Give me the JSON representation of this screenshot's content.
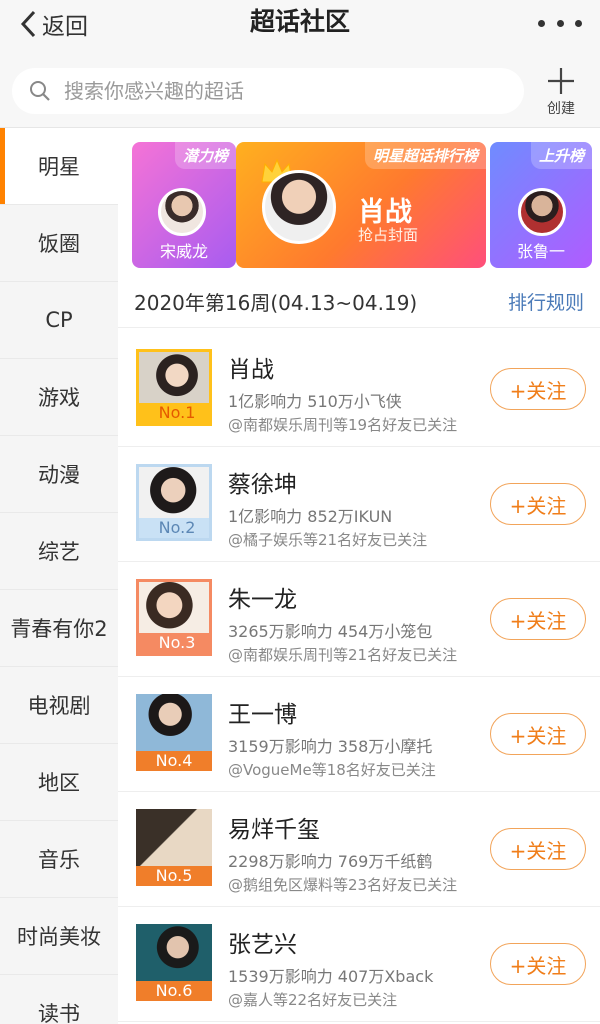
{
  "header": {
    "back_label": "返回",
    "title": "超话社区"
  },
  "search": {
    "placeholder": "搜索你感兴趣的超话",
    "create_label": "创建"
  },
  "sidebar": {
    "items": [
      {
        "label": "明星",
        "active": true
      },
      {
        "label": "饭圈"
      },
      {
        "label": "CP"
      },
      {
        "label": "游戏"
      },
      {
        "label": "动漫"
      },
      {
        "label": "综艺"
      },
      {
        "label": "青春有你2"
      },
      {
        "label": "电视剧"
      },
      {
        "label": "地区"
      },
      {
        "label": "音乐"
      },
      {
        "label": "时尚美妆"
      },
      {
        "label": "读书"
      }
    ]
  },
  "banner": {
    "left": {
      "tag": "潜力榜",
      "name": "宋威龙"
    },
    "center": {
      "tag": "明星超话排行榜",
      "name": "肖战",
      "subtitle": "抢占封面"
    },
    "right": {
      "tag": "上升榜",
      "name": "张鲁一"
    }
  },
  "ranking": {
    "week_label": "2020年第16周(04.13~04.19)",
    "rule_link": "排行规则",
    "follow_label": "+关注",
    "rows": [
      {
        "rank": "No.1",
        "name": "肖战",
        "stats": "1亿影响力 510万小飞侠",
        "friends": "@南都娱乐周刊等19名好友已关注"
      },
      {
        "rank": "No.2",
        "name": "蔡徐坤",
        "stats": "1亿影响力 852万IKUN",
        "friends": "@橘子娱乐等21名好友已关注"
      },
      {
        "rank": "No.3",
        "name": "朱一龙",
        "stats": "3265万影响力 454万小笼包",
        "friends": "@南都娱乐周刊等21名好友已关注"
      },
      {
        "rank": "No.4",
        "name": "王一博",
        "stats": "3159万影响力 358万小摩托",
        "friends": "@VogueMe等18名好友已关注"
      },
      {
        "rank": "No.5",
        "name": "易烊千玺",
        "stats": "2298万影响力 769万千纸鹤",
        "friends": "@鹅组免区爆料等23名好友已关注"
      },
      {
        "rank": "No.6",
        "name": "张艺兴",
        "stats": "1539万影响力 407万Xback",
        "friends": "@嘉人等22名好友已关注"
      }
    ]
  },
  "colors": {
    "accent": "#ff8200",
    "follow_border": "#f2a45a",
    "rule_link": "#4a7ab8"
  }
}
